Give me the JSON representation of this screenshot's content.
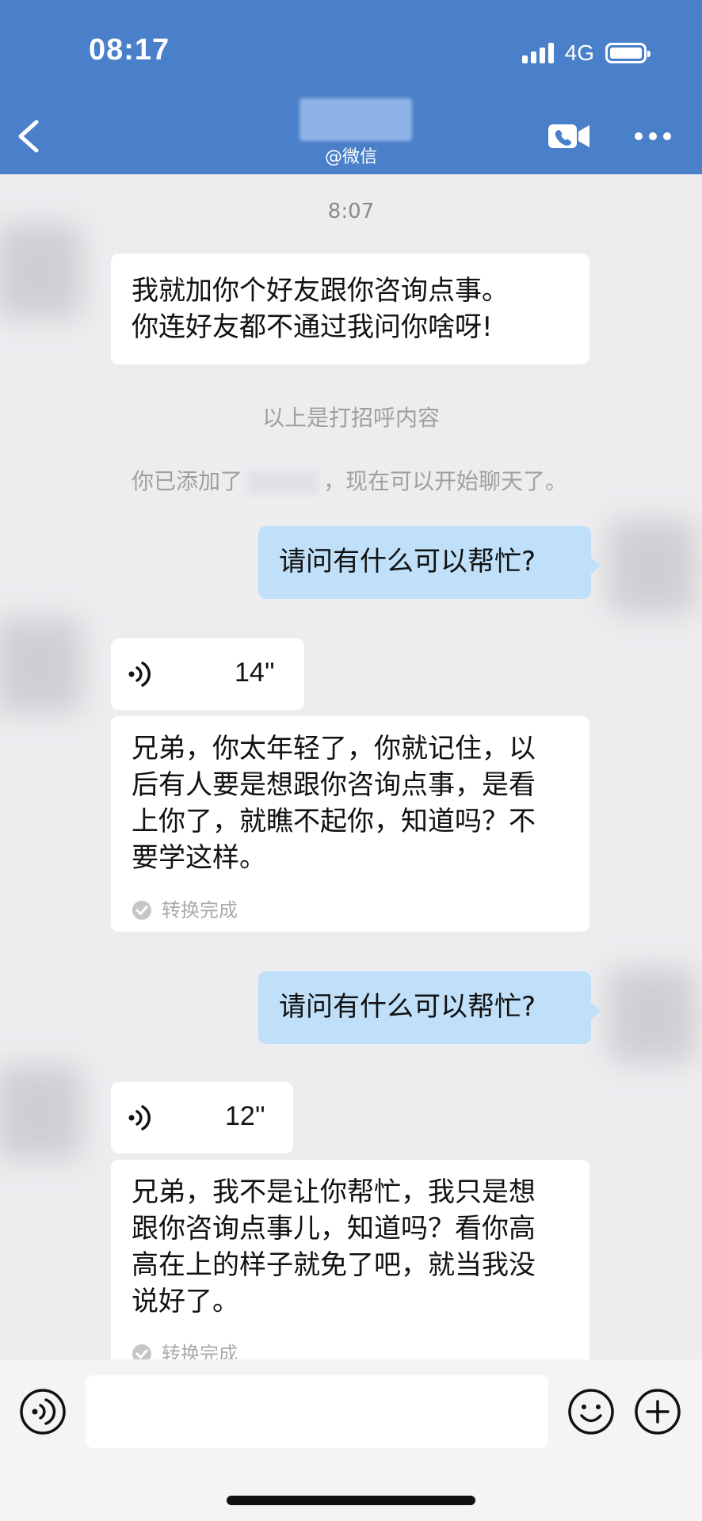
{
  "status_bar": {
    "time": "08:17",
    "network": "4G",
    "signal_icon": "signal-bars-icon",
    "battery_icon": "battery-full-icon"
  },
  "header": {
    "subtitle": "@微信",
    "back_icon": "chevron-left-icon",
    "call_icon": "video-call-icon",
    "more_icon": "more-dots-icon",
    "background_color": "#4a7fc9"
  },
  "chat": {
    "timestamp": "8:07",
    "greeting_message": {
      "lines": [
        "我就加你个好友跟你咨询点事。",
        "你连好友都不通过我问你啥呀!"
      ]
    },
    "greeting_notice": "以上是打招呼内容",
    "added_notice": {
      "prefix": "你已添加了",
      "suffix": "，现在可以开始聊天了。"
    },
    "outgoing_1": "请问有什么可以帮忙?",
    "voice_1": {
      "duration": "14''",
      "transcript_lines": [
        "兄弟，你太年轻了，你就记住，以",
        "后有人要是想跟你咨询点事，是看",
        "上你了，就瞧不起你，知道吗？不",
        "要学这样。"
      ],
      "status": "转换完成"
    },
    "outgoing_2": "请问有什么可以帮忙?",
    "voice_2": {
      "duration": "12''",
      "transcript_lines": [
        "兄弟，我不是让你帮忙，我只是想",
        "跟你咨询点事儿，知道吗？看你高",
        "高在上的样子就免了吧，就当我没",
        "说好了。"
      ],
      "status": "转换完成"
    },
    "outgoing_bubble_color": "#bfe0f8",
    "incoming_bubble_color": "#ffffff"
  },
  "input_bar": {
    "voice_toggle_icon": "voice-mode-icon",
    "text_value": "",
    "emoji_icon": "emoji-icon",
    "plus_icon": "plus-circle-icon"
  }
}
